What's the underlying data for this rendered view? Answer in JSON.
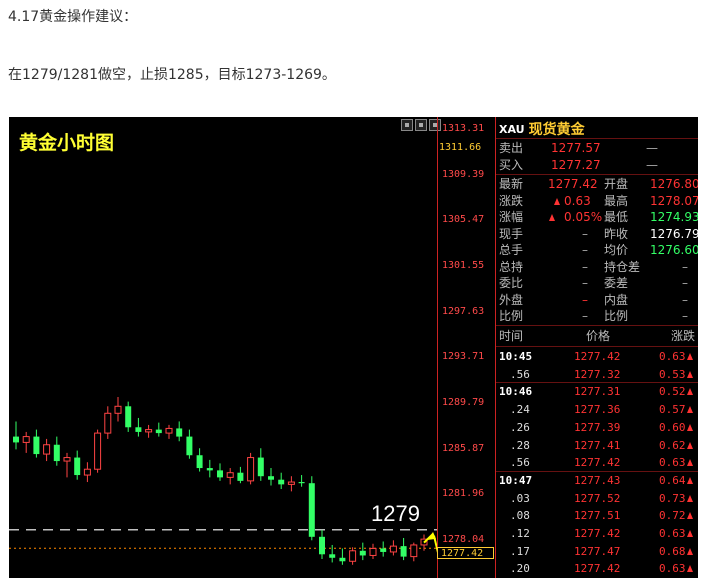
{
  "post": {
    "heading": "4.17黄金操作建议：",
    "advice": "在1279/1281做空，止损1285，目标1273-1269。"
  },
  "chart": {
    "title": "黄金小时图",
    "y_labels": [
      {
        "v": "1313.31",
        "yellow": false
      },
      {
        "v": "1311.66",
        "yellow": true
      },
      {
        "v": "1309.39",
        "yellow": false
      },
      {
        "v": "1305.47",
        "yellow": false
      },
      {
        "v": "1301.55",
        "yellow": false
      },
      {
        "v": "1297.63",
        "yellow": false
      },
      {
        "v": "1293.71",
        "yellow": false
      },
      {
        "v": "1289.79",
        "yellow": false
      },
      {
        "v": "1285.87",
        "yellow": false
      },
      {
        "v": "1281.96",
        "yellow": false
      },
      {
        "v": "1278.04",
        "yellow": false
      }
    ],
    "current_price": "1277.42",
    "annotation": "1279",
    "colors": {
      "up": "#ff3333",
      "down": "#33ff66",
      "bg": "#000000",
      "title": "#ffff33"
    }
  },
  "chart_data": {
    "type": "candlestick",
    "title": "黄金小时图",
    "ylim": [
      1276.0,
      1314.5
    ],
    "reference_line": 1279,
    "current": 1277.42,
    "candles": [
      {
        "o": 1287.0,
        "h": 1288.3,
        "l": 1285.9,
        "c": 1286.5
      },
      {
        "o": 1286.5,
        "h": 1287.4,
        "l": 1285.6,
        "c": 1287.0
      },
      {
        "o": 1287.0,
        "h": 1287.6,
        "l": 1285.2,
        "c": 1285.5
      },
      {
        "o": 1285.5,
        "h": 1286.8,
        "l": 1284.9,
        "c": 1286.3
      },
      {
        "o": 1286.3,
        "h": 1287.0,
        "l": 1284.5,
        "c": 1284.9
      },
      {
        "o": 1284.9,
        "h": 1285.6,
        "l": 1283.5,
        "c": 1285.2
      },
      {
        "o": 1285.2,
        "h": 1285.8,
        "l": 1283.3,
        "c": 1283.7
      },
      {
        "o": 1283.7,
        "h": 1284.8,
        "l": 1283.1,
        "c": 1284.2
      },
      {
        "o": 1284.2,
        "h": 1287.6,
        "l": 1283.9,
        "c": 1287.3
      },
      {
        "o": 1287.3,
        "h": 1289.6,
        "l": 1286.8,
        "c": 1289.0
      },
      {
        "o": 1289.0,
        "h": 1290.4,
        "l": 1288.3,
        "c": 1289.6
      },
      {
        "o": 1289.6,
        "h": 1290.0,
        "l": 1287.4,
        "c": 1287.8
      },
      {
        "o": 1287.8,
        "h": 1288.6,
        "l": 1287.0,
        "c": 1287.4
      },
      {
        "o": 1287.4,
        "h": 1288.0,
        "l": 1286.9,
        "c": 1287.6
      },
      {
        "o": 1287.6,
        "h": 1288.2,
        "l": 1287.0,
        "c": 1287.3
      },
      {
        "o": 1287.3,
        "h": 1288.0,
        "l": 1286.8,
        "c": 1287.7
      },
      {
        "o": 1287.7,
        "h": 1288.3,
        "l": 1286.6,
        "c": 1287.0
      },
      {
        "o": 1287.0,
        "h": 1287.6,
        "l": 1285.1,
        "c": 1285.4
      },
      {
        "o": 1285.4,
        "h": 1286.0,
        "l": 1284.0,
        "c": 1284.3
      },
      {
        "o": 1284.3,
        "h": 1285.0,
        "l": 1283.5,
        "c": 1284.1
      },
      {
        "o": 1284.1,
        "h": 1284.7,
        "l": 1283.2,
        "c": 1283.5
      },
      {
        "o": 1283.5,
        "h": 1284.3,
        "l": 1282.9,
        "c": 1283.9
      },
      {
        "o": 1283.9,
        "h": 1284.4,
        "l": 1283.0,
        "c": 1283.2
      },
      {
        "o": 1283.2,
        "h": 1285.6,
        "l": 1282.9,
        "c": 1285.2
      },
      {
        "o": 1285.2,
        "h": 1286.0,
        "l": 1283.2,
        "c": 1283.6
      },
      {
        "o": 1283.6,
        "h": 1284.3,
        "l": 1282.8,
        "c": 1283.3
      },
      {
        "o": 1283.3,
        "h": 1283.9,
        "l": 1282.5,
        "c": 1282.9
      },
      {
        "o": 1282.9,
        "h": 1283.6,
        "l": 1282.3,
        "c": 1283.1
      },
      {
        "o": 1283.1,
        "h": 1283.7,
        "l": 1282.7,
        "c": 1283.0
      },
      {
        "o": 1283.0,
        "h": 1283.6,
        "l": 1278.1,
        "c": 1278.4
      },
      {
        "o": 1278.4,
        "h": 1279.0,
        "l": 1276.5,
        "c": 1276.9
      },
      {
        "o": 1276.9,
        "h": 1277.7,
        "l": 1276.2,
        "c": 1276.6
      },
      {
        "o": 1276.6,
        "h": 1277.4,
        "l": 1276.0,
        "c": 1276.3
      },
      {
        "o": 1276.3,
        "h": 1277.5,
        "l": 1276.0,
        "c": 1277.2
      },
      {
        "o": 1277.2,
        "h": 1277.9,
        "l": 1276.4,
        "c": 1276.8
      },
      {
        "o": 1276.8,
        "h": 1277.8,
        "l": 1276.5,
        "c": 1277.4
      },
      {
        "o": 1277.4,
        "h": 1278.0,
        "l": 1276.7,
        "c": 1277.1
      },
      {
        "o": 1277.1,
        "h": 1278.1,
        "l": 1276.8,
        "c": 1277.6
      },
      {
        "o": 1277.6,
        "h": 1278.3,
        "l": 1276.4,
        "c": 1276.7
      },
      {
        "o": 1276.7,
        "h": 1277.9,
        "l": 1276.3,
        "c": 1277.7
      },
      {
        "o": 1277.7,
        "h": 1278.6,
        "l": 1277.2,
        "c": 1278.2
      }
    ]
  },
  "quote": {
    "code": "XAU",
    "name": "现货黄金",
    "sell": {
      "label": "卖出",
      "value": "1277.57",
      "extra": "—"
    },
    "buy": {
      "label": "买入",
      "value": "1277.27",
      "extra": "—"
    },
    "rows": [
      {
        "l1": "最新",
        "v1": "1277.42",
        "c1": "red",
        "up1": false,
        "l2": "开盘",
        "v2": "1276.80",
        "c2": "red"
      },
      {
        "l1": "涨跌",
        "v1": "0.63",
        "c1": "red",
        "up1": true,
        "l2": "最高",
        "v2": "1278.07",
        "c2": "red"
      },
      {
        "l1": "涨幅",
        "v1": "0.05%",
        "c1": "red",
        "up1": true,
        "l2": "最低",
        "v2": "1274.93",
        "c2": "green"
      },
      {
        "l1": "现手",
        "v1": "–",
        "c1": "gray",
        "up1": false,
        "l2": "昨收",
        "v2": "1276.79",
        "c2": "white"
      },
      {
        "l1": "总手",
        "v1": "–",
        "c1": "gray",
        "up1": false,
        "l2": "均价",
        "v2": "1276.60",
        "c2": "green"
      },
      {
        "l1": "总持",
        "v1": "–",
        "c1": "gray",
        "up1": false,
        "l2": "持仓差",
        "v2": "–",
        "c2": "gray"
      },
      {
        "l1": "委比",
        "v1": "–",
        "c1": "gray",
        "up1": false,
        "l2": "委差",
        "v2": "–",
        "c2": "gray"
      },
      {
        "l1": "外盘",
        "v1": "–",
        "c1": "red",
        "up1": false,
        "l2": "内盘",
        "v2": "–",
        "c2": "gray"
      },
      {
        "l1": "比例",
        "v1": "–",
        "c1": "gray",
        "up1": false,
        "l2": "比例",
        "v2": "–",
        "c2": "gray"
      }
    ],
    "ticks_header": {
      "time": "时间",
      "price": "价格",
      "change": "涨跌"
    },
    "ticks": [
      {
        "t": "10:45",
        "bold": true,
        "p": "1277.42",
        "c": "0.63"
      },
      {
        "t": ".56",
        "bold": false,
        "p": "1277.32",
        "c": "0.53"
      },
      {
        "t": "10:46",
        "bold": true,
        "p": "1277.31",
        "c": "0.52"
      },
      {
        "t": ".24",
        "bold": false,
        "p": "1277.36",
        "c": "0.57"
      },
      {
        "t": ".26",
        "bold": false,
        "p": "1277.39",
        "c": "0.60"
      },
      {
        "t": ".28",
        "bold": false,
        "p": "1277.41",
        "c": "0.62"
      },
      {
        "t": ".56",
        "bold": false,
        "p": "1277.42",
        "c": "0.63"
      },
      {
        "t": "10:47",
        "bold": true,
        "p": "1277.43",
        "c": "0.64"
      },
      {
        "t": ".03",
        "bold": false,
        "p": "1277.52",
        "c": "0.73"
      },
      {
        "t": ".08",
        "bold": false,
        "p": "1277.51",
        "c": "0.72"
      },
      {
        "t": ".12",
        "bold": false,
        "p": "1277.42",
        "c": "0.63"
      },
      {
        "t": ".17",
        "bold": false,
        "p": "1277.47",
        "c": "0.68"
      },
      {
        "t": ".20",
        "bold": false,
        "p": "1277.42",
        "c": "0.63"
      }
    ]
  }
}
